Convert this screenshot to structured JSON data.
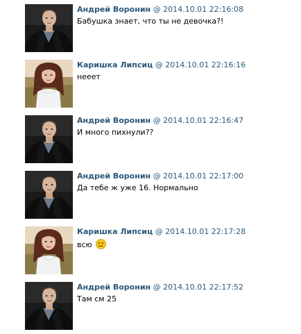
{
  "messages": [
    {
      "author": "Андрей Воронин",
      "at": "@",
      "time": "2014.10.01 22:16:08",
      "text": "Бабушка знает, что ты не девочка?!",
      "avatar": "male-avatar"
    },
    {
      "author": "Каришка Липсиц",
      "at": "@",
      "time": "2014.10.01 22:16:16",
      "text": "нееет",
      "avatar": "female-avatar"
    },
    {
      "author": "Андрей Воронин",
      "at": "@",
      "time": "2014.10.01 22:16:47",
      "text": "И много пихнули??",
      "avatar": "male-avatar"
    },
    {
      "author": "Андрей Воронин",
      "at": "@",
      "time": "2014.10.01 22:17:00",
      "text": "Да тебе ж уже 16. Нормально",
      "avatar": "male-avatar"
    },
    {
      "author": "Каришка Липсиц",
      "at": "@",
      "time": "2014.10.01 22:17:28",
      "text": "всю",
      "avatar": "female-avatar",
      "emoji": "confused-smiley-icon"
    },
    {
      "author": "Андрей Воронин",
      "at": "@",
      "time": "2014.10.01 22:17:52",
      "text": "Там см 25",
      "avatar": "male-avatar"
    }
  ],
  "colors": {
    "author": "#2b587a",
    "text": "#000000",
    "background": "#ffffff",
    "smiley": "#f5c518"
  }
}
